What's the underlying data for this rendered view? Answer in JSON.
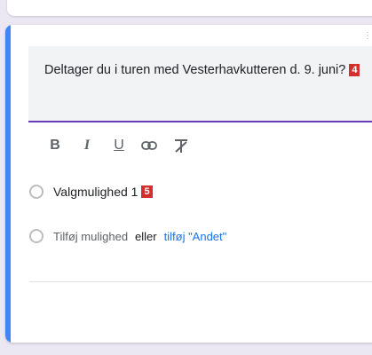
{
  "question": {
    "text": "Deltager du i turen med Vesterhavkutteren d. 9. juni?",
    "badge": "4"
  },
  "toolbar": {
    "bold": "B",
    "italic": "I",
    "underline": "U",
    "link_icon": "link-icon",
    "clear_format_icon": "clear-format-icon"
  },
  "options": {
    "option1_label": "Valgmulighed 1",
    "option1_badge": "5",
    "add_option": "Tilføj mulighed",
    "or": "eller",
    "add_other": "tilføj \"Andet\""
  },
  "colors": {
    "accent": "#4285f4",
    "underline": "#673ab7",
    "link": "#1a73e8",
    "badge": "#d32f2f"
  }
}
